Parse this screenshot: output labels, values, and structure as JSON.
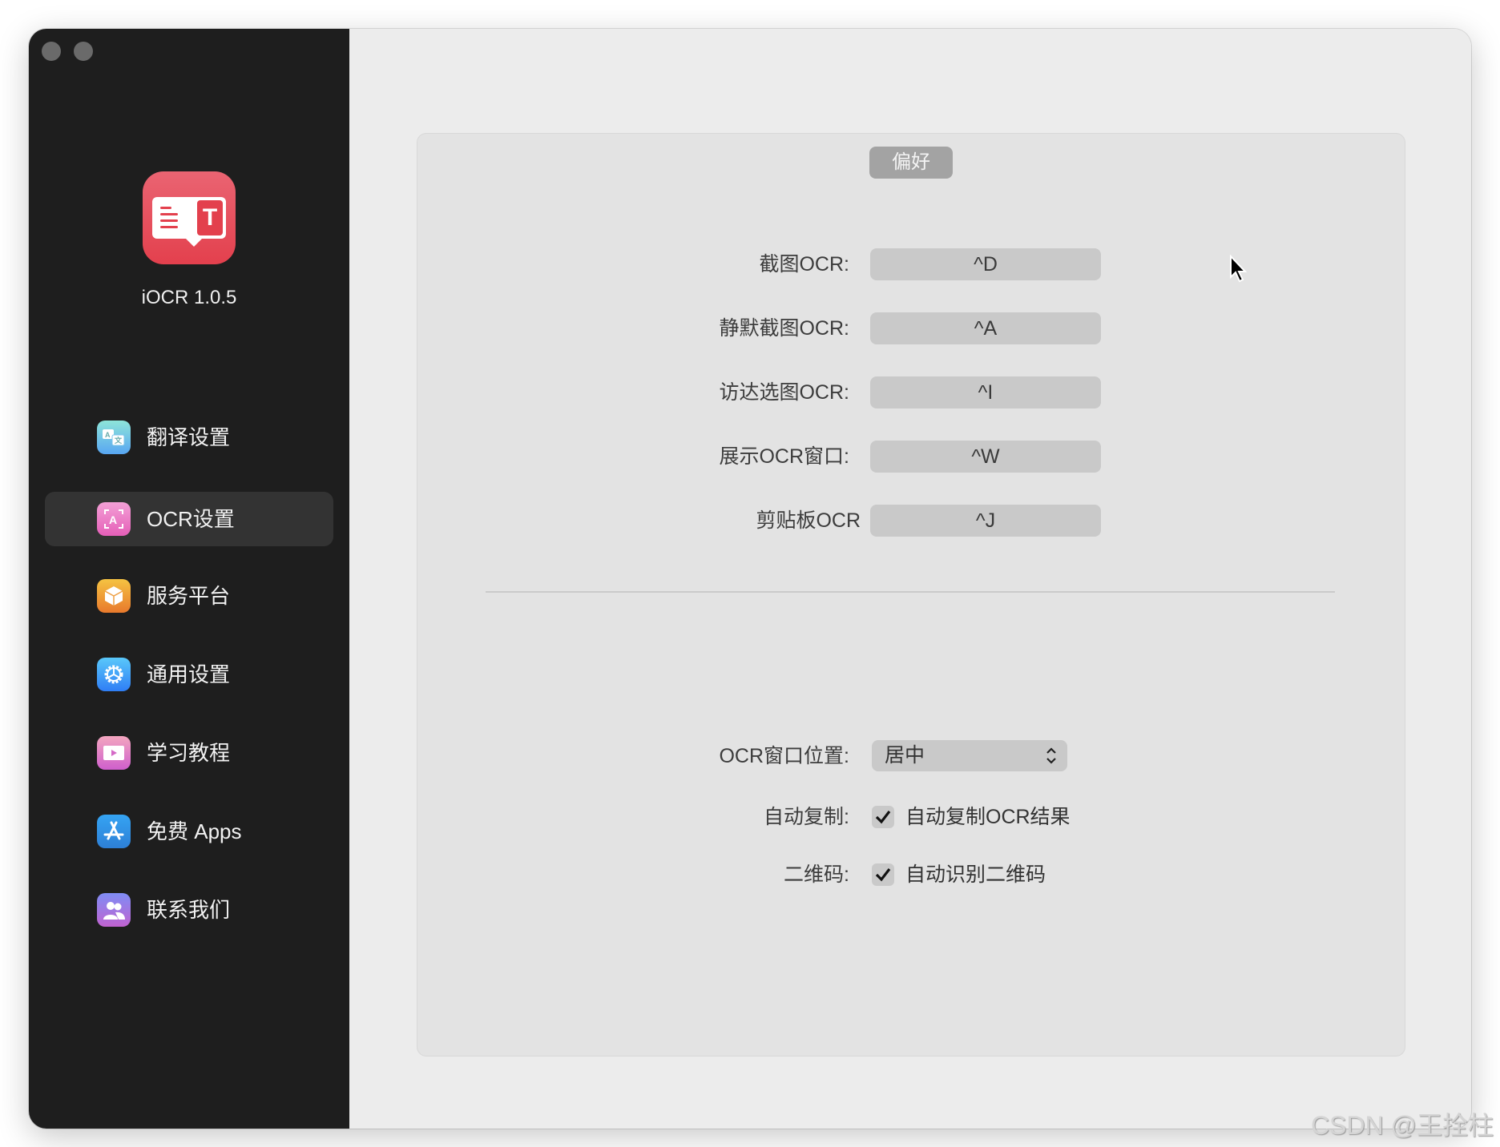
{
  "window": {
    "controls": [
      "close",
      "minimize"
    ]
  },
  "sidebar": {
    "app_name_version": "iOCR 1.0.5",
    "items": [
      {
        "label": "翻译设置",
        "icon": "translate-icon",
        "colors": [
          "#8ee5d9",
          "#58a6f2"
        ],
        "active": false
      },
      {
        "label": "OCR设置",
        "icon": "ocr-scan-icon",
        "colors": [
          "#f3a0d6",
          "#e55fb8"
        ],
        "active": true
      },
      {
        "label": "服务平台",
        "icon": "cube-icon",
        "colors": [
          "#f5c342",
          "#e8792c"
        ],
        "active": false
      },
      {
        "label": "通用设置",
        "icon": "gear-icon",
        "colors": [
          "#5ac8fa",
          "#2f7ef5"
        ],
        "active": false
      },
      {
        "label": "学习教程",
        "icon": "video-icon",
        "colors": [
          "#f3a6bf",
          "#cf5fcc"
        ],
        "active": false
      },
      {
        "label": "免费 Apps",
        "icon": "app-store-icon",
        "colors": [
          "#35a4f3",
          "#2d7fd6"
        ],
        "active": false
      },
      {
        "label": "联系我们",
        "icon": "contacts-icon",
        "colors": [
          "#7f8df5",
          "#c163d0"
        ],
        "active": false
      }
    ]
  },
  "main": {
    "section_title": "偏好",
    "shortcuts": [
      {
        "label": "截图OCR:",
        "value": "^D"
      },
      {
        "label": "静默截图OCR:",
        "value": "^A"
      },
      {
        "label": "访达选图OCR:",
        "value": "^I"
      },
      {
        "label": "展示OCR窗口:",
        "value": "^W"
      },
      {
        "label": "剪贴板OCR",
        "value": "^J"
      }
    ],
    "window_position": {
      "label": "OCR窗口位置:",
      "selected": "居中"
    },
    "auto_copy": {
      "label": "自动复制:",
      "checkbox_label": "自动复制OCR结果",
      "checked": true
    },
    "qr_code": {
      "label": "二维码:",
      "checkbox_label": "自动识别二维码",
      "checked": true
    }
  },
  "watermark": "CSDN @王拴柱"
}
